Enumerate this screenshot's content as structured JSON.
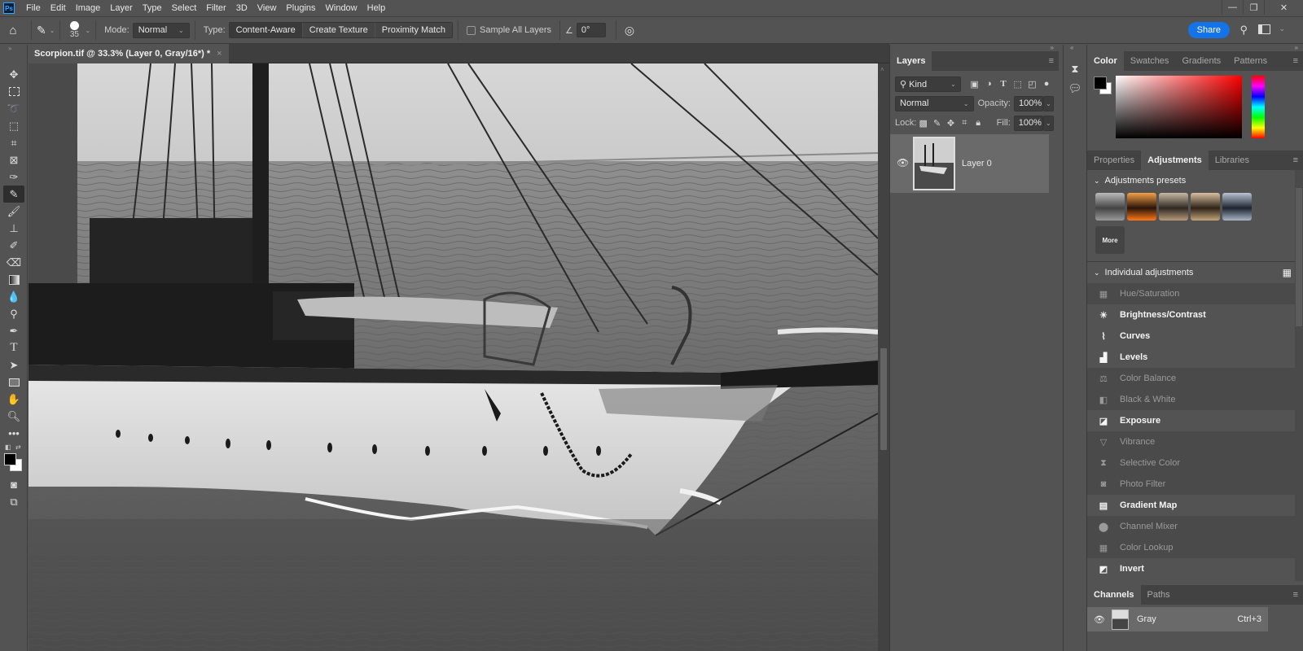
{
  "app": {
    "logo": "Ps"
  },
  "menubar": {
    "items": [
      "File",
      "Edit",
      "Image",
      "Layer",
      "Type",
      "Select",
      "Filter",
      "3D",
      "View",
      "Plugins",
      "Window",
      "Help"
    ]
  },
  "window_controls": {
    "minimize": "—",
    "restore": "❐",
    "close": "✕"
  },
  "options_bar": {
    "brush_size": "35",
    "mode_label": "Mode:",
    "mode_value": "Normal",
    "type_label": "Type:",
    "type_options": [
      "Content-Aware",
      "Create Texture",
      "Proximity Match"
    ],
    "type_selected": "Content-Aware",
    "sample_all_layers_label": "Sample All Layers",
    "sample_all_layers_checked": false,
    "angle_value": "0°",
    "share_label": "Share"
  },
  "tools": [
    "move",
    "marquee",
    "lasso",
    "object-select",
    "crop",
    "frame",
    "eyedropper",
    "spot-healing-brush",
    "brush",
    "clone-stamp",
    "history-brush",
    "eraser",
    "gradient",
    "blur",
    "dodge",
    "pen",
    "type",
    "path-select",
    "rectangle",
    "hand",
    "zoom",
    "more"
  ],
  "active_tool": "spot-healing-brush",
  "colors": {
    "foreground": "#000000",
    "background": "#ffffff",
    "accent": "#1473e6"
  },
  "document": {
    "tab_title": "Scorpion.tif @ 33.3% (Layer 0, Gray/16*) *",
    "close": "×"
  },
  "layers_panel": {
    "tab": "Layers",
    "filter_label": "Kind",
    "blend_mode": "Normal",
    "opacity_label": "Opacity:",
    "opacity_value": "100%",
    "lock_label": "Lock:",
    "fill_label": "Fill:",
    "fill_value": "100%",
    "layers": [
      {
        "name": "Layer 0",
        "visible": true
      }
    ]
  },
  "color_panel": {
    "tabs": [
      "Color",
      "Swatches",
      "Gradients",
      "Patterns"
    ],
    "active_tab": "Color",
    "hue_color": "#ff0000"
  },
  "adjustments_panel": {
    "tabs": [
      "Properties",
      "Adjustments",
      "Libraries"
    ],
    "active_tab": "Adjustments",
    "presets_header": "Adjustments presets",
    "more_label": "More",
    "individual_header": "Individual adjustments",
    "items": [
      {
        "label": "Hue/Saturation",
        "enabled": false,
        "icon": "hue-saturation-icon",
        "glyph": "▦"
      },
      {
        "label": "Brightness/Contrast",
        "enabled": true,
        "icon": "brightness-contrast-icon",
        "glyph": "☀"
      },
      {
        "label": "Curves",
        "enabled": true,
        "icon": "curves-icon",
        "glyph": "⌇"
      },
      {
        "label": "Levels",
        "enabled": true,
        "icon": "levels-icon",
        "glyph": "▟"
      },
      {
        "label": "Color Balance",
        "enabled": false,
        "icon": "color-balance-icon",
        "glyph": "⚖"
      },
      {
        "label": "Black & White",
        "enabled": false,
        "icon": "black-white-icon",
        "glyph": "◧"
      },
      {
        "label": "Exposure",
        "enabled": true,
        "icon": "exposure-icon",
        "glyph": "◪"
      },
      {
        "label": "Vibrance",
        "enabled": false,
        "icon": "vibrance-icon",
        "glyph": "▽"
      },
      {
        "label": "Selective Color",
        "enabled": false,
        "icon": "selective-color-icon",
        "glyph": "⧗"
      },
      {
        "label": "Photo Filter",
        "enabled": false,
        "icon": "photo-filter-icon",
        "glyph": "◙"
      },
      {
        "label": "Gradient Map",
        "enabled": true,
        "icon": "gradient-map-icon",
        "glyph": "▤"
      },
      {
        "label": "Channel Mixer",
        "enabled": false,
        "icon": "channel-mixer-icon",
        "glyph": "⬤"
      },
      {
        "label": "Color Lookup",
        "enabled": false,
        "icon": "color-lookup-icon",
        "glyph": "▦"
      },
      {
        "label": "Invert",
        "enabled": true,
        "icon": "invert-icon",
        "glyph": "◩"
      }
    ]
  },
  "channels_panel": {
    "tabs": [
      "Channels",
      "Paths"
    ],
    "active_tab": "Channels",
    "channels": [
      {
        "name": "Gray",
        "shortcut": "Ctrl+3"
      }
    ]
  }
}
